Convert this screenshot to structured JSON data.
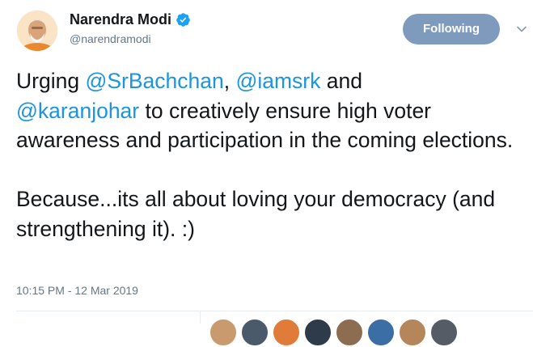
{
  "author": {
    "display_name": "Narendra Modi",
    "handle": "@narendramodi",
    "verified": true
  },
  "follow_button": {
    "label": "Following"
  },
  "tweet": {
    "line1_prefix": "Urging ",
    "mention1": "@SrBachchan",
    "sep1": ", ",
    "mention2": "@iamsrk",
    "sep2": " and",
    "mention3": "@karanjohar",
    "line2_rest": " to creatively ensure high voter awareness and participation in the coming elections.",
    "para2": "Because...its all about loving your democracy (and strengthening it). :)"
  },
  "timestamp": "10:15 PM - 12 Mar 2019",
  "colors": {
    "mention": "#1c94e0",
    "follow_button_bg": "#7e9bbd",
    "verified": "#1da1f2"
  },
  "icons": {
    "verified": "verified-badge-icon",
    "caret": "chevron-down-icon"
  },
  "likers_count_visible": 8
}
